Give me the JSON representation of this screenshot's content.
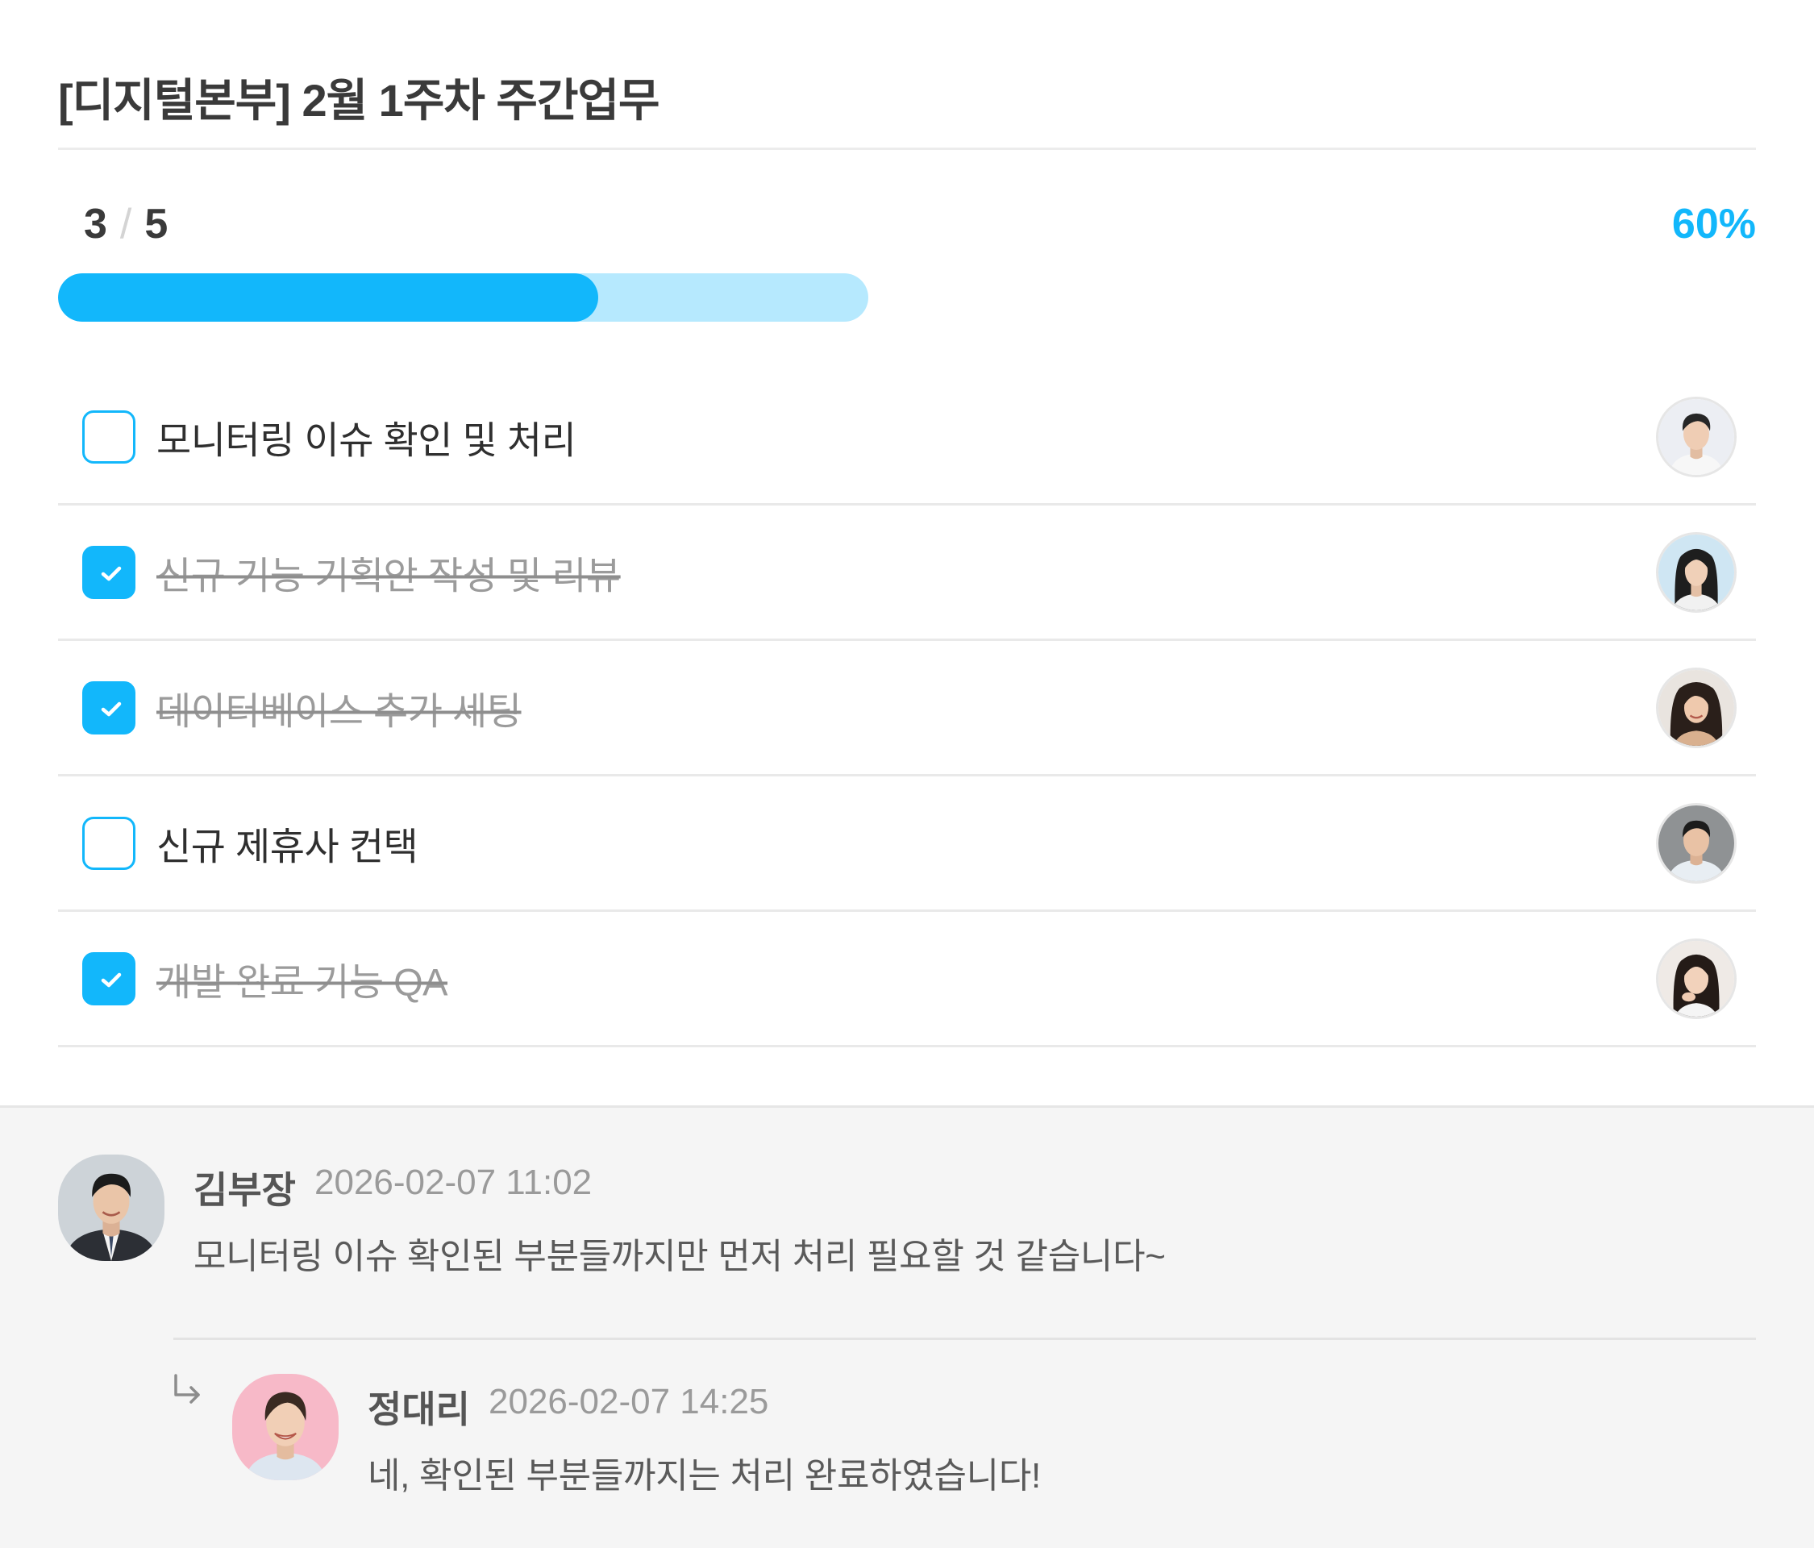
{
  "header": {
    "title": "[디지털본부] 2월 1주차 주간업무"
  },
  "progress": {
    "done": "3",
    "separator": "/",
    "total": "5",
    "percent_label": "60%",
    "fraction": 0.6667
  },
  "tasks": [
    {
      "label": "모니터링 이슈 확인 및 처리",
      "checked": false,
      "avatar": "young-man-avatar"
    },
    {
      "label": "신규 기능 기획안 작성 및 리뷰",
      "checked": true,
      "avatar": "woman-long-hair-avatar"
    },
    {
      "label": "데이터베이스 추가 세팅",
      "checked": true,
      "avatar": "woman-smiling-avatar"
    },
    {
      "label": "신규 제휴사 컨택",
      "checked": false,
      "avatar": "man-shirt-avatar"
    },
    {
      "label": "개발 완료 기능 QA",
      "checked": true,
      "avatar": "woman-hand-chin-avatar"
    }
  ],
  "comments": [
    {
      "author": "김부장",
      "time": "2026-02-07 11:02",
      "text": "모니터링 이슈 확인된 부분들까지만 먼저 처리 필요할 것 같습니다~",
      "avatar": "man-suit-avatar"
    }
  ],
  "reply": {
    "author": "정대리",
    "time": "2026-02-07 14:25",
    "text": "네, 확인된 부분들까지는 처리 완료하였습니다!",
    "avatar": "woman-pink-background-avatar",
    "icon": "reply-arrow-icon"
  },
  "colors": {
    "accent": "#12b7fb",
    "accent_light": "#b6e9fe",
    "comment_background": "#f5f5f5"
  }
}
